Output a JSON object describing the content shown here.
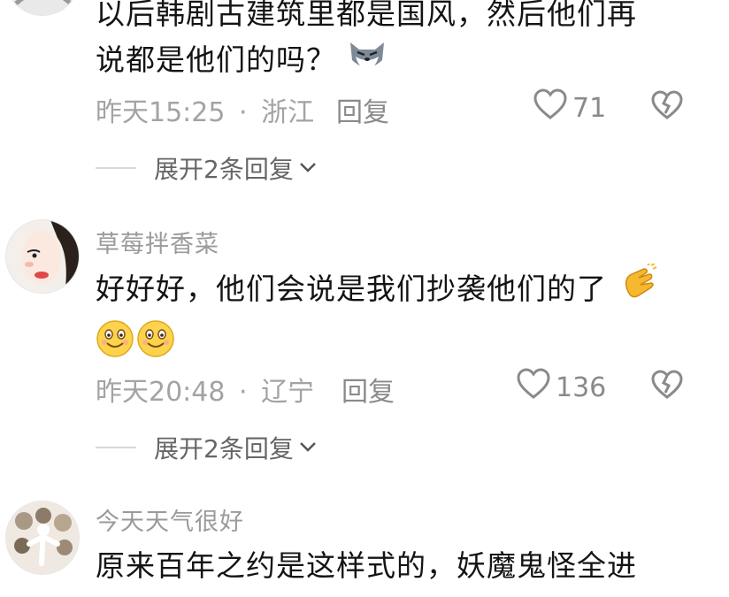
{
  "comments": [
    {
      "text_lines": [
        "以后韩剧古建筑里都是国风，然后他们再",
        "说都是他们的吗？"
      ],
      "emoji": "wolf-face-emoji",
      "time": "昨天15:25",
      "separator": "·",
      "location": "浙江",
      "reply_label": "回复",
      "likes": "71",
      "expand_label": "展开2条回复"
    },
    {
      "username": "草莓拌香菜",
      "text_lines": [
        "好好好，他们会说是我们抄袭他们的了"
      ],
      "emoji": "clapping-hands-emoji",
      "emoji_line": [
        "smiling-face-emoji",
        "smiling-face-emoji"
      ],
      "time": "昨天20:48",
      "separator": "·",
      "location": "辽宁",
      "reply_label": "回复",
      "likes": "136",
      "expand_label": "展开2条回复"
    },
    {
      "username": "今天天气很好",
      "text_lines": [
        "原来百年之约是这样式的，妖魔鬼怪全进"
      ]
    }
  ],
  "colors": {
    "username": "#9a9a9a",
    "meta": "#a3a3a3",
    "body": "#141414",
    "icon": "#8a8a8a"
  }
}
